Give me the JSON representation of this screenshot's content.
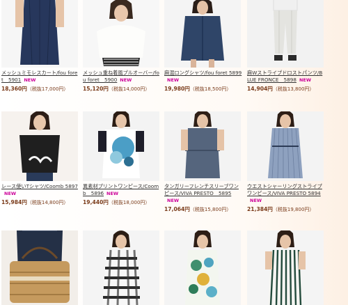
{
  "products": [
    {
      "name": "メッシュミモレスカート/fou foret　5901",
      "new": "NEW",
      "price": "18,360円",
      "tax": "（税抜17,000円）"
    },
    {
      "name": "メッシュ重ね着風プルオーバー/fou foret　5900",
      "new": "NEW",
      "price": "15,120円",
      "tax": "（税抜14,000円）"
    },
    {
      "name": "麻混ロングシャツ/fou foret 5899",
      "new": "NEW",
      "price": "19,980円",
      "tax": "（税抜18,500円）"
    },
    {
      "name": "麻Wストライプドロストパンツ/BLUE FRONCE　5898",
      "new": "NEW",
      "price": "14,904円",
      "tax": "（税抜13,800円）"
    },
    {
      "name": "レース使いTシャツ/Coomb 5897",
      "new": "NEW",
      "price": "15,984円",
      "tax": "（税抜14,800円）"
    },
    {
      "name": "異素材プリントワンピース/Coomb　5896",
      "new": "NEW",
      "price": "19,440円",
      "tax": "（税抜18,000円）"
    },
    {
      "name": "タンガリーフレンチスリーブワンピース/VIVA PRESTO　5895",
      "new": "NEW",
      "price": "17,064円",
      "tax": "（税抜15,800円）"
    },
    {
      "name": "ウエストシャーリングストライプワンピース/VIVA PRESTO 5894",
      "new": "NEW",
      "price": "21,384円",
      "tax": "（税抜19,800円）"
    },
    {
      "name": "",
      "new": "",
      "price": "",
      "tax": ""
    },
    {
      "name": "",
      "new": "",
      "price": "",
      "tax": ""
    },
    {
      "name": "",
      "new": "",
      "price": "",
      "tax": ""
    },
    {
      "name": "",
      "new": "",
      "price": "",
      "tax": ""
    }
  ],
  "colors": {
    "new_badge": "#cc0099",
    "price": "#7a3b1a",
    "background_right": "#fdf0e4"
  }
}
